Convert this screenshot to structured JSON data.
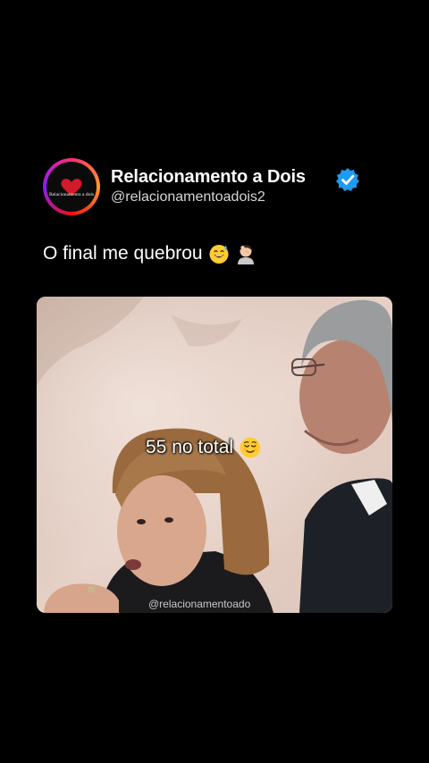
{
  "post": {
    "account_name": "Relacionamento a Dois",
    "handle": "@relacionamentoadois2",
    "avatar_text": "Relacionamento a dois",
    "text": "O final me quebrou",
    "text_emojis": [
      "sweat-smile-emoji",
      "man-facepalming-emoji"
    ],
    "verified": true
  },
  "media": {
    "caption": "55 no total",
    "caption_emoji": "relieved-face-emoji",
    "watermark": "@relacionamentoado"
  },
  "colors": {
    "background": "#000000",
    "verified_badge": "#1d9bf0",
    "handle_text": "#d6d6d6"
  }
}
